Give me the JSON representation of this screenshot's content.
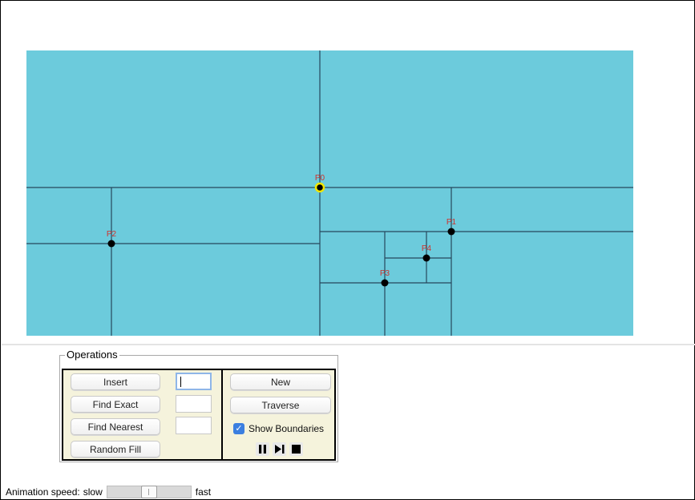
{
  "colors": {
    "canvas_bg": "#6ccbdc",
    "boundary_line": "#27475c",
    "point_fill": "#000000",
    "highlight_ring": "#f2e600",
    "point_label": "#d0302a",
    "panel_bg": "#f5f3dc",
    "checkbox_accent": "#3b7fe0"
  },
  "kdtree": {
    "points": [
      {
        "label": "P0",
        "highlighted": true
      },
      {
        "label": "P1",
        "highlighted": false
      },
      {
        "label": "P2",
        "highlighted": false
      },
      {
        "label": "P3",
        "highlighted": false
      },
      {
        "label": "P4",
        "highlighted": false
      }
    ]
  },
  "operations": {
    "legend": "Operations",
    "insert_label": "Insert",
    "find_exact_label": "Find Exact",
    "find_nearest_label": "Find Nearest",
    "random_fill_label": "Random Fill",
    "insert_value": "",
    "find_exact_value": "",
    "find_nearest_value": "",
    "new_label": "New",
    "traverse_label": "Traverse",
    "show_boundaries_label": "Show Boundaries",
    "show_boundaries_checked": true,
    "media_icons": [
      "pause-icon",
      "step-forward-icon",
      "stop-icon"
    ]
  },
  "animation": {
    "label": "Animation speed:",
    "slow_label": "slow",
    "fast_label": "fast",
    "speed_fraction": 0.5
  }
}
